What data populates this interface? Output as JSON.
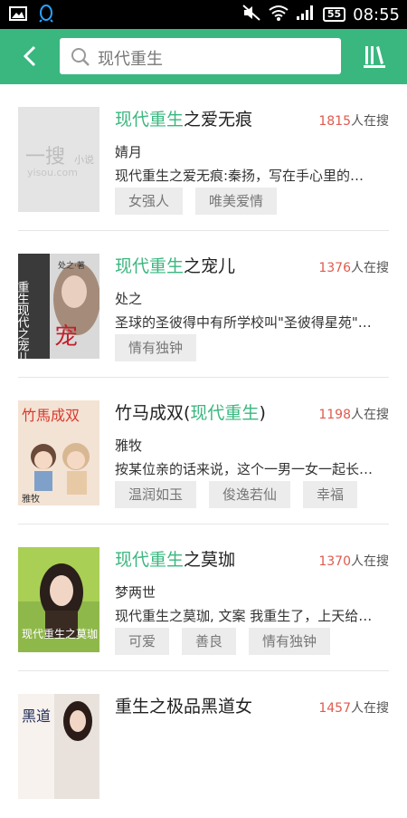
{
  "status_bar": {
    "time": "08:55",
    "battery": "55",
    "icons": [
      "image-icon",
      "qq-icon",
      "mute-icon",
      "wifi-icon",
      "signal-icon",
      "battery-icon"
    ]
  },
  "header": {
    "search_query": "现代重生",
    "accent_color": "#3ab77f"
  },
  "books": [
    {
      "title_hl": "现代重生",
      "title_rest": "之爱无痕",
      "hot_count": "1815",
      "hot_suffix": "人在搜",
      "author": "婧月",
      "desc": "现代重生之爱无痕:秦扬，写在手心里的…",
      "tags": [
        "女强人",
        "唯美爱情"
      ],
      "cover_text": "一搜",
      "cover_sub": "yisou.com",
      "cover_small": "小说"
    },
    {
      "title_hl": "现代重生",
      "title_rest": "之宠儿",
      "hot_count": "1376",
      "hot_suffix": "人在搜",
      "author": "处之",
      "desc": "圣球的圣彼得中有所学校叫\"圣彼得星苑\"…",
      "tags": [
        "情有独钟"
      ],
      "cover_text": "重生现代之宠儿",
      "cover_sub": "处之·著"
    },
    {
      "title_pre": "竹马成双(",
      "title_hl": "现代重生",
      "title_rest": ")",
      "hot_count": "1198",
      "hot_suffix": "人在搜",
      "author": "雅牧",
      "desc": "按某位亲的话来说，这个一男一女一起长…",
      "tags": [
        "温润如玉",
        "俊逸若仙",
        "幸福"
      ],
      "cover_text": "竹馬成双",
      "cover_sub": "雅牧"
    },
    {
      "title_hl": "现代重生",
      "title_rest": "之莫珈",
      "hot_count": "1370",
      "hot_suffix": "人在搜",
      "author": "梦两世",
      "desc": "现代重生之莫珈, 文案 我重生了，上天给…",
      "tags": [
        "可爱",
        "善良",
        "情有独钟"
      ],
      "cover_text": "现代重生之莫珈",
      "cover_sub": ""
    },
    {
      "title_rest": "重生之极品黑道女",
      "hot_count": "1457",
      "hot_suffix": "人在搜",
      "cover_text": "黑道"
    }
  ]
}
